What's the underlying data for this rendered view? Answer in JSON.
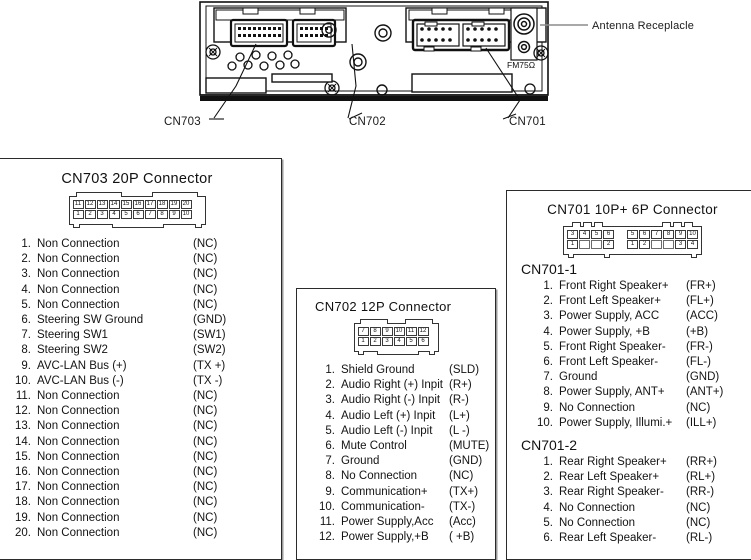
{
  "illustration": {
    "callouts": [
      {
        "id": "cn703",
        "label": "CN703"
      },
      {
        "id": "cn702",
        "label": "CN702"
      },
      {
        "id": "cn701",
        "label": "CN701"
      },
      {
        "id": "antenna",
        "label": "Antenna Receplacle"
      }
    ],
    "fm_label": "FM75Ω"
  },
  "panels": {
    "cn703": {
      "title": "CN703  20P Connector",
      "connector": {
        "top_row": [
          "11",
          "12",
          "13",
          "14",
          "15",
          "16",
          "17",
          "18",
          "19",
          "20"
        ],
        "bottom_row": [
          "1",
          "2",
          "3",
          "4",
          "5",
          "6",
          "7",
          "8",
          "9",
          "10"
        ]
      },
      "pins": [
        {
          "num": "1.",
          "name": "Non Connection",
          "code": "(NC)"
        },
        {
          "num": "2.",
          "name": "Non Connection",
          "code": "(NC)"
        },
        {
          "num": "3.",
          "name": "Non Connection",
          "code": "(NC)"
        },
        {
          "num": "4.",
          "name": "Non Connection",
          "code": "(NC)"
        },
        {
          "num": "5.",
          "name": "Non Connection",
          "code": "(NC)"
        },
        {
          "num": "6.",
          "name": "Steering SW Ground",
          "code": "(GND)"
        },
        {
          "num": "7.",
          "name": "Steering SW1",
          "code": "(SW1)"
        },
        {
          "num": "8.",
          "name": "Steering SW2",
          "code": "(SW2)"
        },
        {
          "num": "9.",
          "name": "AVC-LAN Bus (+)",
          "code": "(TX +)"
        },
        {
          "num": "10.",
          "name": "AVC-LAN Bus (-)",
          "code": "(TX -)"
        },
        {
          "num": "11.",
          "name": "Non Connection",
          "code": "(NC)"
        },
        {
          "num": "12.",
          "name": "Non Connection",
          "code": "(NC)"
        },
        {
          "num": "13.",
          "name": "Non Connection",
          "code": "(NC)"
        },
        {
          "num": "14.",
          "name": "Non Connection",
          "code": "(NC)"
        },
        {
          "num": "15.",
          "name": "Non Connection",
          "code": "(NC)"
        },
        {
          "num": "16.",
          "name": "Non Connection",
          "code": "(NC)"
        },
        {
          "num": "17.",
          "name": "Non Connection",
          "code": "(NC)"
        },
        {
          "num": "18.",
          "name": "Non Connection",
          "code": "(NC)"
        },
        {
          "num": "19.",
          "name": "Non Connection",
          "code": "(NC)"
        },
        {
          "num": "20.",
          "name": "Non Connection",
          "code": "(NC)"
        }
      ]
    },
    "cn702": {
      "title": "CN702  12P Connector",
      "connector": {
        "top_row": [
          "7",
          "8",
          "9",
          "10",
          "11",
          "12"
        ],
        "bottom_row": [
          "1",
          "2",
          "3",
          "4",
          "5",
          "6"
        ]
      },
      "pins": [
        {
          "num": "1.",
          "name": "Shield Ground",
          "code": "(SLD)"
        },
        {
          "num": "2.",
          "name": "Audio Right (+) Inpit",
          "code": "(R+)"
        },
        {
          "num": "3.",
          "name": "Audio Right (-) Inpit",
          "code": "(R-)"
        },
        {
          "num": "4.",
          "name": "Audio Left (+) Inpit",
          "code": "(L+)"
        },
        {
          "num": "5.",
          "name": "Audio Left (-) Inpit",
          "code": "(L -)"
        },
        {
          "num": "6.",
          "name": "Mute Control",
          "code": "(MUTE)"
        },
        {
          "num": "7.",
          "name": "Ground",
          "code": "(GND)"
        },
        {
          "num": "8.",
          "name": "No Connection",
          "code": "(NC)"
        },
        {
          "num": "9.",
          "name": "Communication+",
          "code": "(TX+)"
        },
        {
          "num": "10.",
          "name": "Communication-",
          "code": "(TX-)"
        },
        {
          "num": "11.",
          "name": "Power Supply,Acc",
          "code": "(Acc)"
        },
        {
          "num": "12.",
          "name": "Power Supply,+B",
          "code": "( +B)"
        }
      ]
    },
    "cn701": {
      "title": "CN701  10P+ 6P Connector",
      "connector": {
        "left_top_row": [
          "3",
          "4",
          "5",
          "6"
        ],
        "left_bottom_row": [
          "1",
          "",
          "",
          "2"
        ],
        "right_top_row": [
          "5",
          "6",
          "7",
          "8",
          "9",
          "10"
        ],
        "right_bottom_row": [
          "1",
          "2",
          "",
          "3",
          "4"
        ]
      },
      "section1": {
        "heading": "CN701-1",
        "pins": [
          {
            "num": "1.",
            "name": "Front Right Speaker+",
            "code": "(FR+)"
          },
          {
            "num": "2.",
            "name": "Front Left Speaker+",
            "code": "(FL+)"
          },
          {
            "num": "3.",
            "name": "Power Supply, ACC",
            "code": "(ACC)"
          },
          {
            "num": "4.",
            "name": "Power Supply, +B",
            "code": "(+B)"
          },
          {
            "num": "5.",
            "name": "Front Right Speaker-",
            "code": "(FR-)"
          },
          {
            "num": "6.",
            "name": "Front Left Speaker-",
            "code": "(FL-)"
          },
          {
            "num": "7.",
            "name": "Ground",
            "code": "(GND)"
          },
          {
            "num": "8.",
            "name": "Power Supply, ANT+",
            "code": "(ANT+)"
          },
          {
            "num": "9.",
            "name": "No Connection",
            "code": "(NC)"
          },
          {
            "num": "10.",
            "name": "Power Supply, Illumi.+",
            "code": "(ILL+)"
          }
        ]
      },
      "section2": {
        "heading": "CN701-2",
        "pins": [
          {
            "num": "1.",
            "name": "Rear Right Speaker+",
            "code": "(RR+)"
          },
          {
            "num": "2.",
            "name": "Rear Left Speaker+",
            "code": "(RL+)"
          },
          {
            "num": "3.",
            "name": "Rear Right Speaker-",
            "code": "(RR-)"
          },
          {
            "num": "4.",
            "name": "No Connection",
            "code": "(NC)"
          },
          {
            "num": "5.",
            "name": "No Connection",
            "code": "(NC)"
          },
          {
            "num": "6.",
            "name": "Rear Left Speaker-",
            "code": "(RL-)"
          }
        ]
      }
    }
  }
}
